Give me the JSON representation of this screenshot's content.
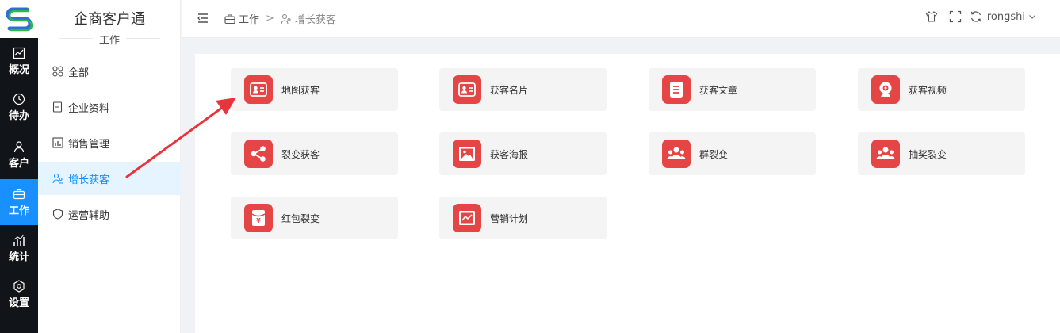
{
  "app": {
    "title": "企商客户通",
    "section": "工作"
  },
  "rail": [
    {
      "label": "概况",
      "icon": "trend-chart-icon",
      "active": false
    },
    {
      "label": "待办",
      "icon": "clock-icon",
      "active": false
    },
    {
      "label": "客户",
      "icon": "user-icon",
      "active": false
    },
    {
      "label": "工作",
      "icon": "briefcase-icon",
      "active": true
    },
    {
      "label": "统计",
      "icon": "bar-chart-icon",
      "active": false
    },
    {
      "label": "设置",
      "icon": "gear-icon",
      "active": false
    }
  ],
  "sidebar": {
    "items": [
      {
        "label": "全部",
        "icon": "grid-icon",
        "active": false
      },
      {
        "label": "企业资料",
        "icon": "document-icon",
        "active": false
      },
      {
        "label": "销售管理",
        "icon": "sales-chart-icon",
        "active": false
      },
      {
        "label": "增长获客",
        "icon": "users-icon",
        "active": true
      },
      {
        "label": "运营辅助",
        "icon": "shield-icon",
        "active": false
      }
    ]
  },
  "header": {
    "breadcrumb": [
      "工作",
      "增长获客"
    ],
    "username": "rongshi"
  },
  "cards": [
    {
      "label": "地图获客",
      "icon": "id-card-icon"
    },
    {
      "label": "获客名片",
      "icon": "business-card-icon"
    },
    {
      "label": "获客文章",
      "icon": "article-icon"
    },
    {
      "label": "获客视频",
      "icon": "camera-icon"
    },
    {
      "label": "裂变获客",
      "icon": "share-icon"
    },
    {
      "label": "获客海报",
      "icon": "poster-icon"
    },
    {
      "label": "群裂变",
      "icon": "group-icon"
    },
    {
      "label": "抽奖裂变",
      "icon": "group-icon"
    },
    {
      "label": "红包裂变",
      "icon": "red-envelope-icon"
    },
    {
      "label": "营销计划",
      "icon": "marketing-plan-icon"
    }
  ],
  "colors": {
    "accent": "#1890ff",
    "card_icon": "#e64545",
    "rail_bg": "#111418",
    "arrow": "#e8353d"
  }
}
